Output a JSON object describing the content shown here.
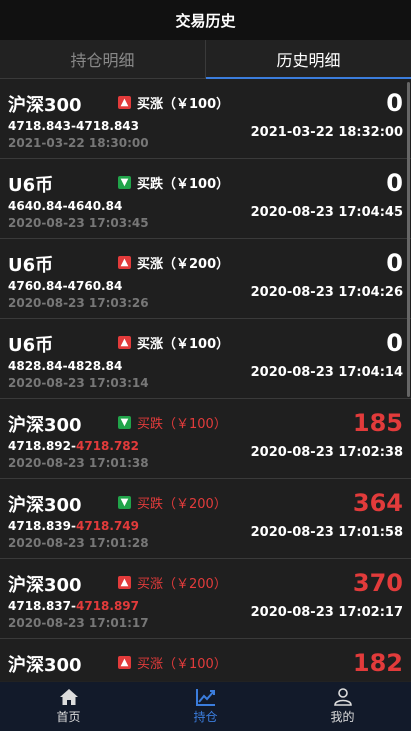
{
  "header": {
    "title": "交易历史"
  },
  "tabs": [
    {
      "label": "持仓明细",
      "active": false
    },
    {
      "label": "历史明细",
      "active": true
    }
  ],
  "rows": [
    {
      "name": "沪深300",
      "direction": "up",
      "dir_text": "买涨（￥100）",
      "dir_color": "white",
      "open_price": "4718.843-",
      "close_price": "4718.843",
      "close_color": "white",
      "open_time": "2021-03-22 18:30:00",
      "pnl": "0",
      "pnl_color": "white",
      "close_time": "2021-03-22 18:32:00"
    },
    {
      "name": "U6币",
      "direction": "down",
      "dir_text": "买跌（￥100）",
      "dir_color": "white",
      "open_price": "4640.84-",
      "close_price": "4640.84",
      "close_color": "white",
      "open_time": "2020-08-23 17:03:45",
      "pnl": "0",
      "pnl_color": "white",
      "close_time": "2020-08-23 17:04:45"
    },
    {
      "name": "U6币",
      "direction": "up",
      "dir_text": "买涨（￥200）",
      "dir_color": "white",
      "open_price": "4760.84-",
      "close_price": "4760.84",
      "close_color": "white",
      "open_time": "2020-08-23 17:03:26",
      "pnl": "0",
      "pnl_color": "white",
      "close_time": "2020-08-23 17:04:26"
    },
    {
      "name": "U6币",
      "direction": "up",
      "dir_text": "买涨（￥100）",
      "dir_color": "white",
      "open_price": "4828.84-",
      "close_price": "4828.84",
      "close_color": "white",
      "open_time": "2020-08-23 17:03:14",
      "pnl": "0",
      "pnl_color": "white",
      "close_time": "2020-08-23 17:04:14"
    },
    {
      "name": "沪深300",
      "direction": "down",
      "dir_text": "买跌（￥100）",
      "dir_color": "red",
      "open_price": "4718.892-",
      "close_price": "4718.782",
      "close_color": "red",
      "open_time": "2020-08-23 17:01:38",
      "pnl": "185",
      "pnl_color": "red",
      "close_time": "2020-08-23 17:02:38"
    },
    {
      "name": "沪深300",
      "direction": "down",
      "dir_text": "买跌（￥200）",
      "dir_color": "red",
      "open_price": "4718.839-",
      "close_price": "4718.749",
      "close_color": "red",
      "open_time": "2020-08-23 17:01:28",
      "pnl": "364",
      "pnl_color": "red",
      "close_time": "2020-08-23 17:01:58"
    },
    {
      "name": "沪深300",
      "direction": "up",
      "dir_text": "买涨（￥200）",
      "dir_color": "red",
      "open_price": "4718.837-",
      "close_price": "4718.897",
      "close_color": "red",
      "open_time": "2020-08-23 17:01:17",
      "pnl": "370",
      "pnl_color": "red",
      "close_time": "2020-08-23 17:02:17"
    },
    {
      "name": "沪深300",
      "direction": "up",
      "dir_text": "买涨（￥100）",
      "dir_color": "red",
      "open_price": "",
      "close_price": "",
      "close_color": "red",
      "open_time": "",
      "pnl": "182",
      "pnl_color": "red",
      "close_time": ""
    }
  ],
  "bottom_nav": [
    {
      "label": "首页",
      "icon": "home-icon",
      "active": false
    },
    {
      "label": "持仓",
      "icon": "chart-icon",
      "active": true
    },
    {
      "label": "我的",
      "icon": "user-icon",
      "active": false
    }
  ],
  "colors": {
    "red": "#e23b3b",
    "green": "#21a44a",
    "accent": "#3b7ddd"
  }
}
